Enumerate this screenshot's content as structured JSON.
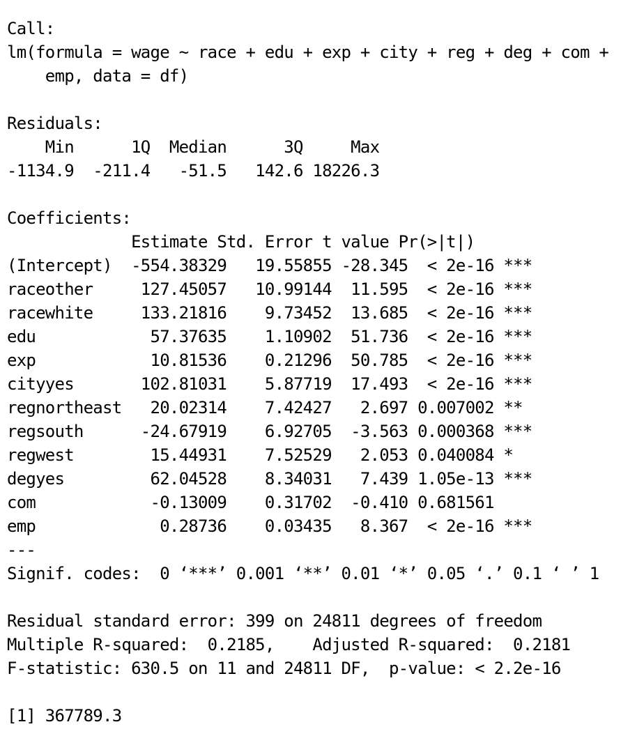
{
  "call": {
    "header": "Call:",
    "line1": "lm(formula = wage ~ race + edu + exp + city + reg + deg + com +",
    "line2": "    emp, data = df)"
  },
  "residuals": {
    "header": "Residuals:",
    "labels": "    Min      1Q  Median      3Q     Max",
    "values": "-1134.9  -211.4   -51.5   142.6 18226.3"
  },
  "coefficients": {
    "header": "Coefficients:",
    "columns": "             Estimate Std. Error t value Pr(>|t|)    ",
    "rows": [
      {
        "name": "(Intercept)",
        "text": "(Intercept)  -554.38329   19.55855 -28.345  < 2e-16 ***"
      },
      {
        "name": "raceother",
        "text": "raceother     127.45057   10.99144  11.595  < 2e-16 ***"
      },
      {
        "name": "racewhite",
        "text": "racewhite     133.21816    9.73452  13.685  < 2e-16 ***"
      },
      {
        "name": "edu",
        "text": "edu            57.37635    1.10902  51.736  < 2e-16 ***"
      },
      {
        "name": "exp",
        "text": "exp            10.81536    0.21296  50.785  < 2e-16 ***"
      },
      {
        "name": "cityyes",
        "text": "cityyes       102.81031    5.87719  17.493  < 2e-16 ***"
      },
      {
        "name": "regnortheast",
        "text": "regnortheast   20.02314    7.42427   2.697 0.007002 ** "
      },
      {
        "name": "regsouth",
        "text": "regsouth      -24.67919    6.92705  -3.563 0.000368 ***"
      },
      {
        "name": "regwest",
        "text": "regwest        15.44931    7.52529   2.053 0.040084 *  "
      },
      {
        "name": "degyes",
        "text": "degyes         62.04528    8.34031   7.439 1.05e-13 ***"
      },
      {
        "name": "com",
        "text": "com            -0.13009    0.31702  -0.410 0.681561    "
      },
      {
        "name": "emp",
        "text": "emp             0.28736    0.03435   8.367  < 2e-16 ***"
      }
    ],
    "separator": "---",
    "signif_codes": "Signif. codes:  0 ‘***’ 0.001 ‘**’ 0.01 ‘*’ 0.05 ‘.’ 0.1 ‘ ’ 1"
  },
  "summary": {
    "residual_se": "Residual standard error: 399 on 24811 degrees of freedom",
    "r_squared": "Multiple R-squared:  0.2185,\tAdjusted R-squared:  0.2181 ",
    "f_statistic": "F-statistic: 630.5 on 11 and 24811 DF,  p-value: < 2.2e-16"
  },
  "output": "[1] 367789.3"
}
